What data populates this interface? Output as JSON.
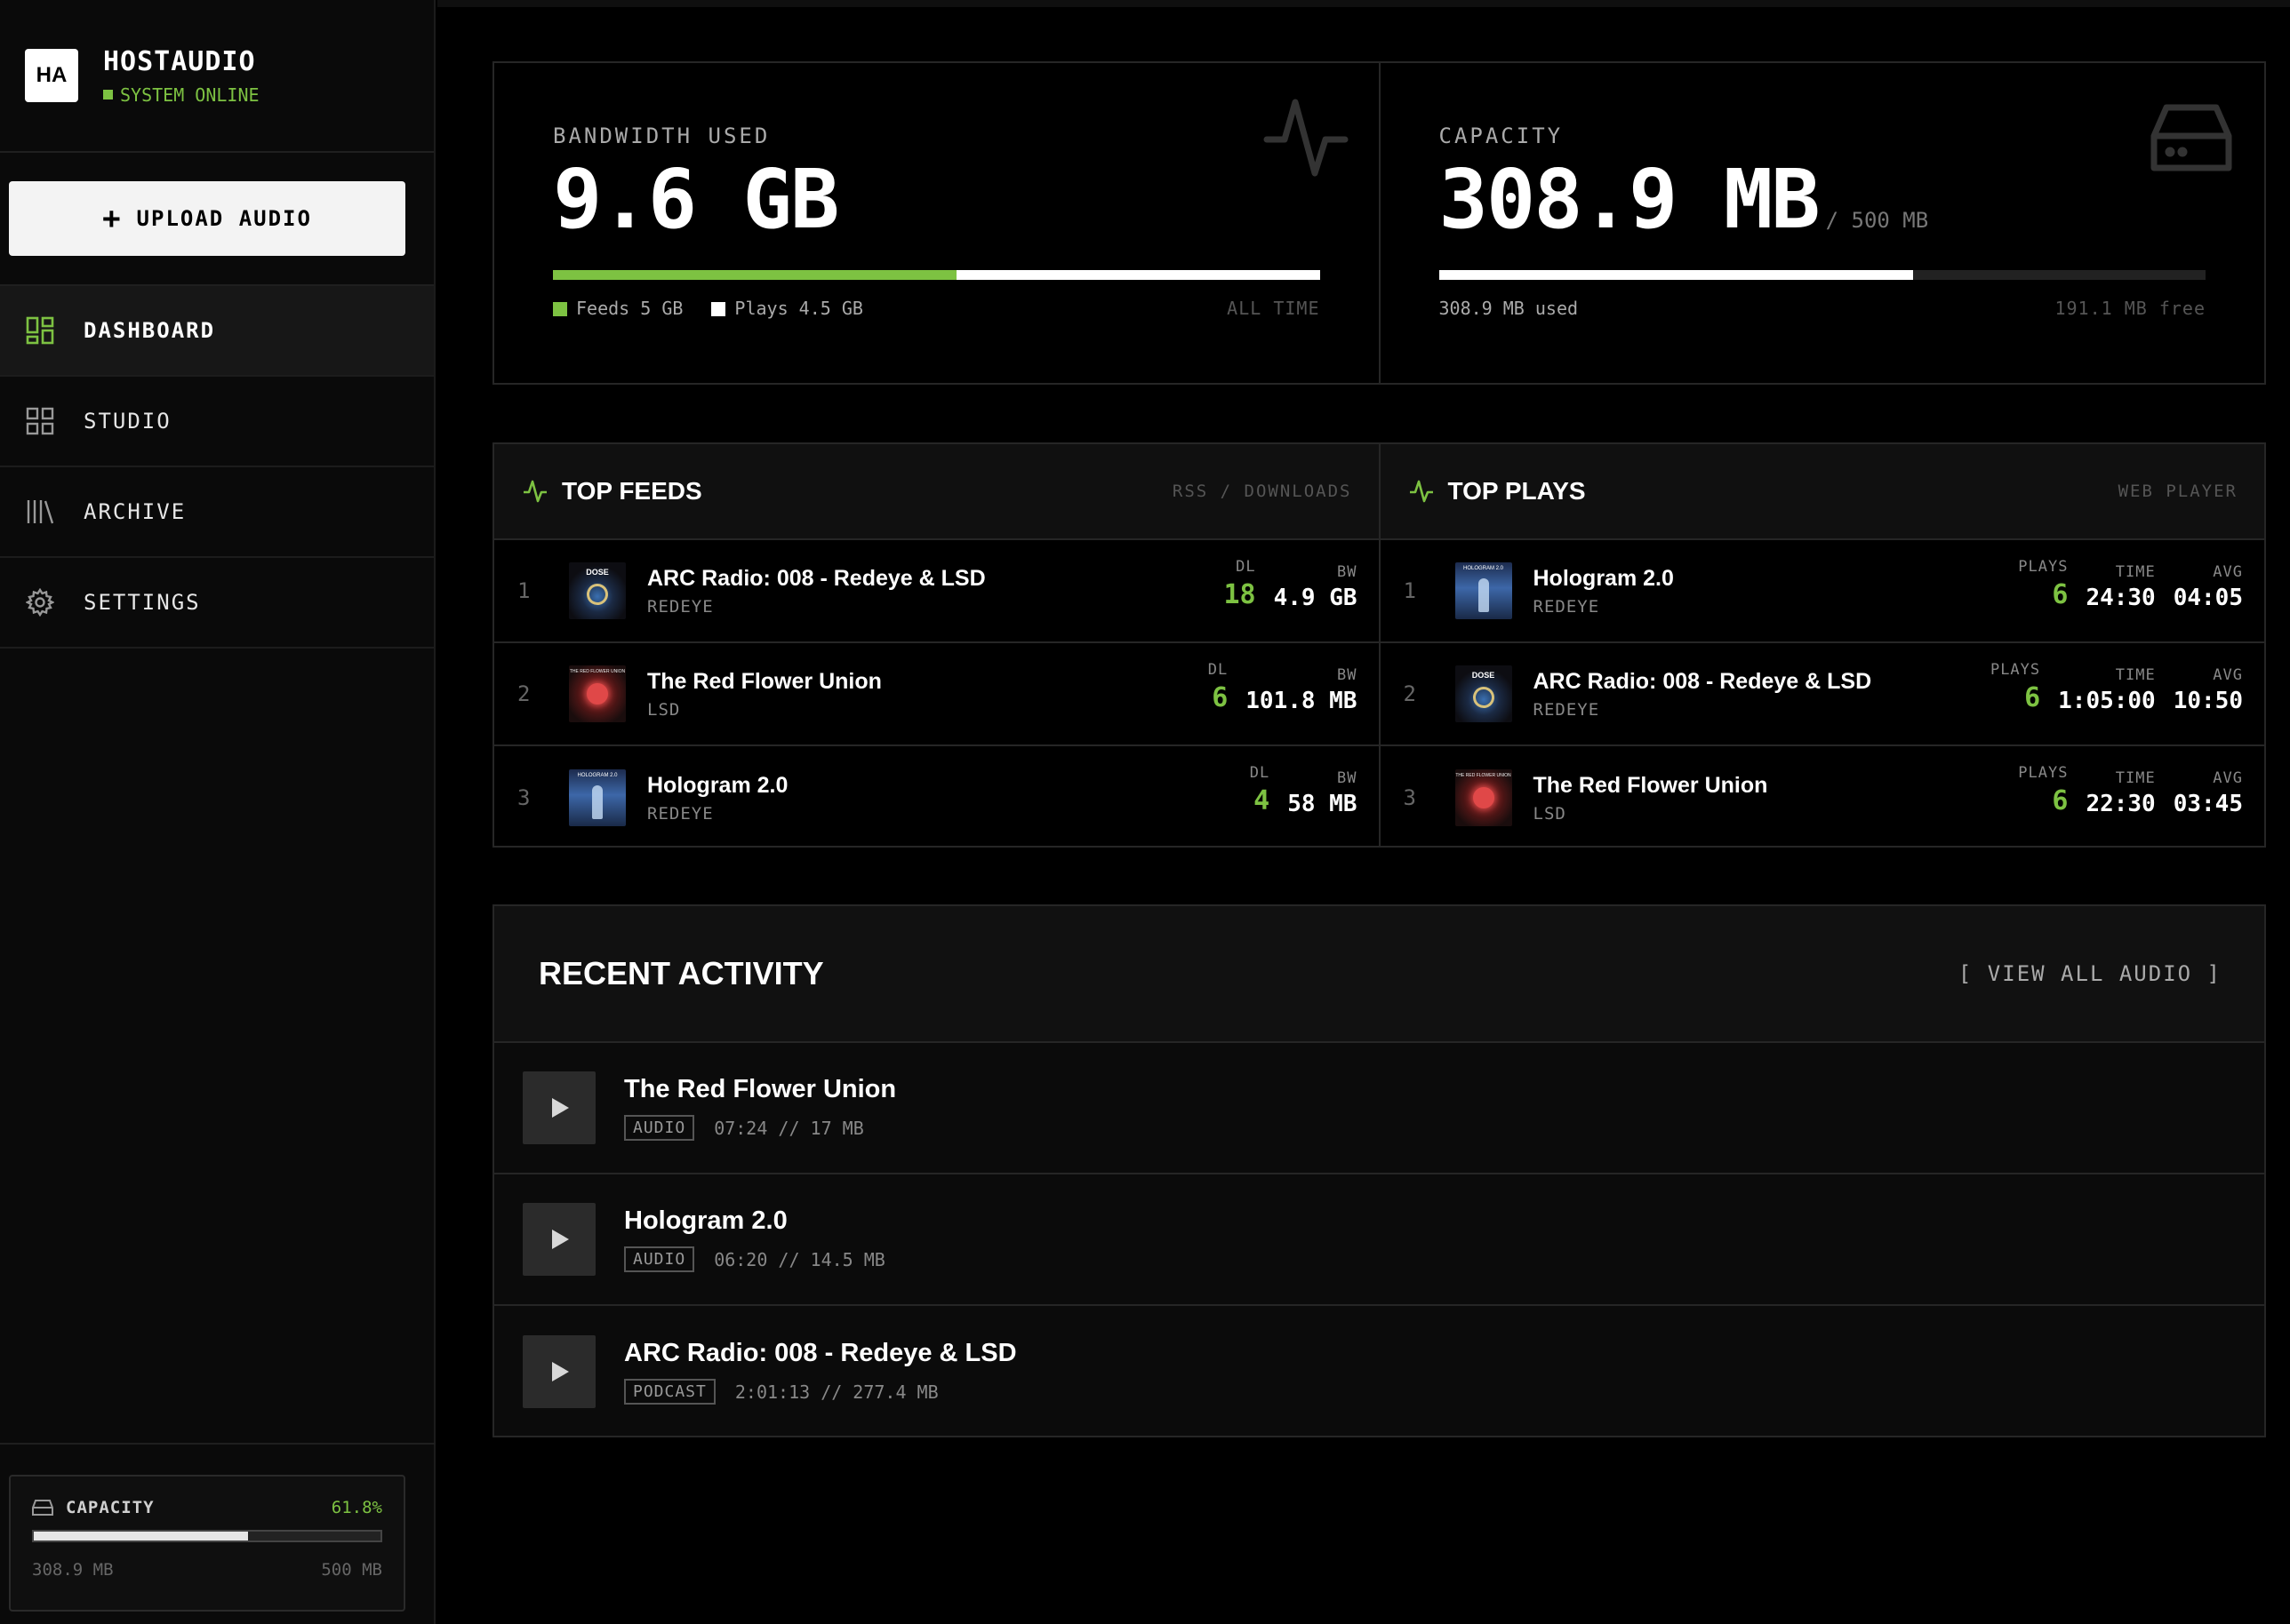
{
  "brand": {
    "logo": "HA",
    "name": "HOSTAUDIO",
    "status": "SYSTEM ONLINE"
  },
  "upload": {
    "label": "UPLOAD AUDIO"
  },
  "nav": [
    {
      "label": "DASHBOARD",
      "icon": "dashboard-icon",
      "active": true
    },
    {
      "label": "STUDIO",
      "icon": "grid-icon",
      "active": false
    },
    {
      "label": "ARCHIVE",
      "icon": "library-icon",
      "active": false
    },
    {
      "label": "SETTINGS",
      "icon": "gear-icon",
      "active": false
    }
  ],
  "sidebar_capacity": {
    "label": "CAPACITY",
    "percent": "61.8%",
    "fill": 0.618,
    "used": "308.9 MB",
    "total": "500 MB"
  },
  "bandwidth": {
    "label": "BANDWIDTH USED",
    "value": "9.6 GB",
    "feeds_fraction": 0.526,
    "feeds_legend": "Feeds 5 GB",
    "plays_legend": "Plays 4.5 GB",
    "period": "ALL TIME"
  },
  "capacity": {
    "label": "CAPACITY",
    "value": "308.9 MB",
    "total": "/ 500 MB",
    "fill": 0.618,
    "used": "308.9 MB used",
    "free": "191.1 MB free"
  },
  "top_feeds": {
    "title": "TOP FEEDS",
    "meta": "RSS / DOWNLOADS",
    "dl_label": "DL",
    "bw_label": "BW",
    "rows": [
      {
        "rank": "1",
        "title": "ARC Radio: 008 - Redeye & LSD",
        "artist": "REDEYE",
        "dl": "18",
        "bw": "4.9 GB",
        "art": "dose"
      },
      {
        "rank": "2",
        "title": "The Red Flower Union",
        "artist": "LSD",
        "dl": "6",
        "bw": "101.8 MB",
        "art": "red"
      },
      {
        "rank": "3",
        "title": "Hologram 2.0",
        "artist": "REDEYE",
        "dl": "4",
        "bw": "58 MB",
        "art": "holo"
      }
    ]
  },
  "top_plays": {
    "title": "TOP PLAYS",
    "meta": "WEB PLAYER",
    "plays_label": "PLAYS",
    "time_label": "TIME",
    "avg_label": "AVG",
    "rows": [
      {
        "rank": "1",
        "title": "Hologram 2.0",
        "artist": "REDEYE",
        "plays": "6",
        "time": "24:30",
        "avg": "04:05",
        "art": "holo"
      },
      {
        "rank": "2",
        "title": "ARC Radio: 008 - Redeye & LSD",
        "artist": "REDEYE",
        "plays": "6",
        "time": "1:05:00",
        "avg": "10:50",
        "art": "dose"
      },
      {
        "rank": "3",
        "title": "The Red Flower Union",
        "artist": "LSD",
        "plays": "6",
        "time": "22:30",
        "avg": "03:45",
        "art": "red"
      }
    ]
  },
  "recent": {
    "title": "RECENT ACTIVITY",
    "view_all": "[ VIEW ALL AUDIO ]",
    "rows": [
      {
        "title": "The Red Flower Union",
        "tag": "AUDIO",
        "meta": "07:24 // 17 MB"
      },
      {
        "title": "Hologram 2.0",
        "tag": "AUDIO",
        "meta": "06:20 // 14.5 MB"
      },
      {
        "title": "ARC Radio: 008 - Redeye & LSD",
        "tag": "PODCAST",
        "meta": "2:01:13 // 277.4 MB"
      }
    ]
  },
  "colors": {
    "accent": "#7dc242",
    "bg": "#000000",
    "panel": "#101010",
    "border": "#262626"
  },
  "art_text": {
    "dose": "DOSE",
    "holo": "HOLOGRAM 2.0",
    "red": "THE RED FLOWER UNION"
  }
}
